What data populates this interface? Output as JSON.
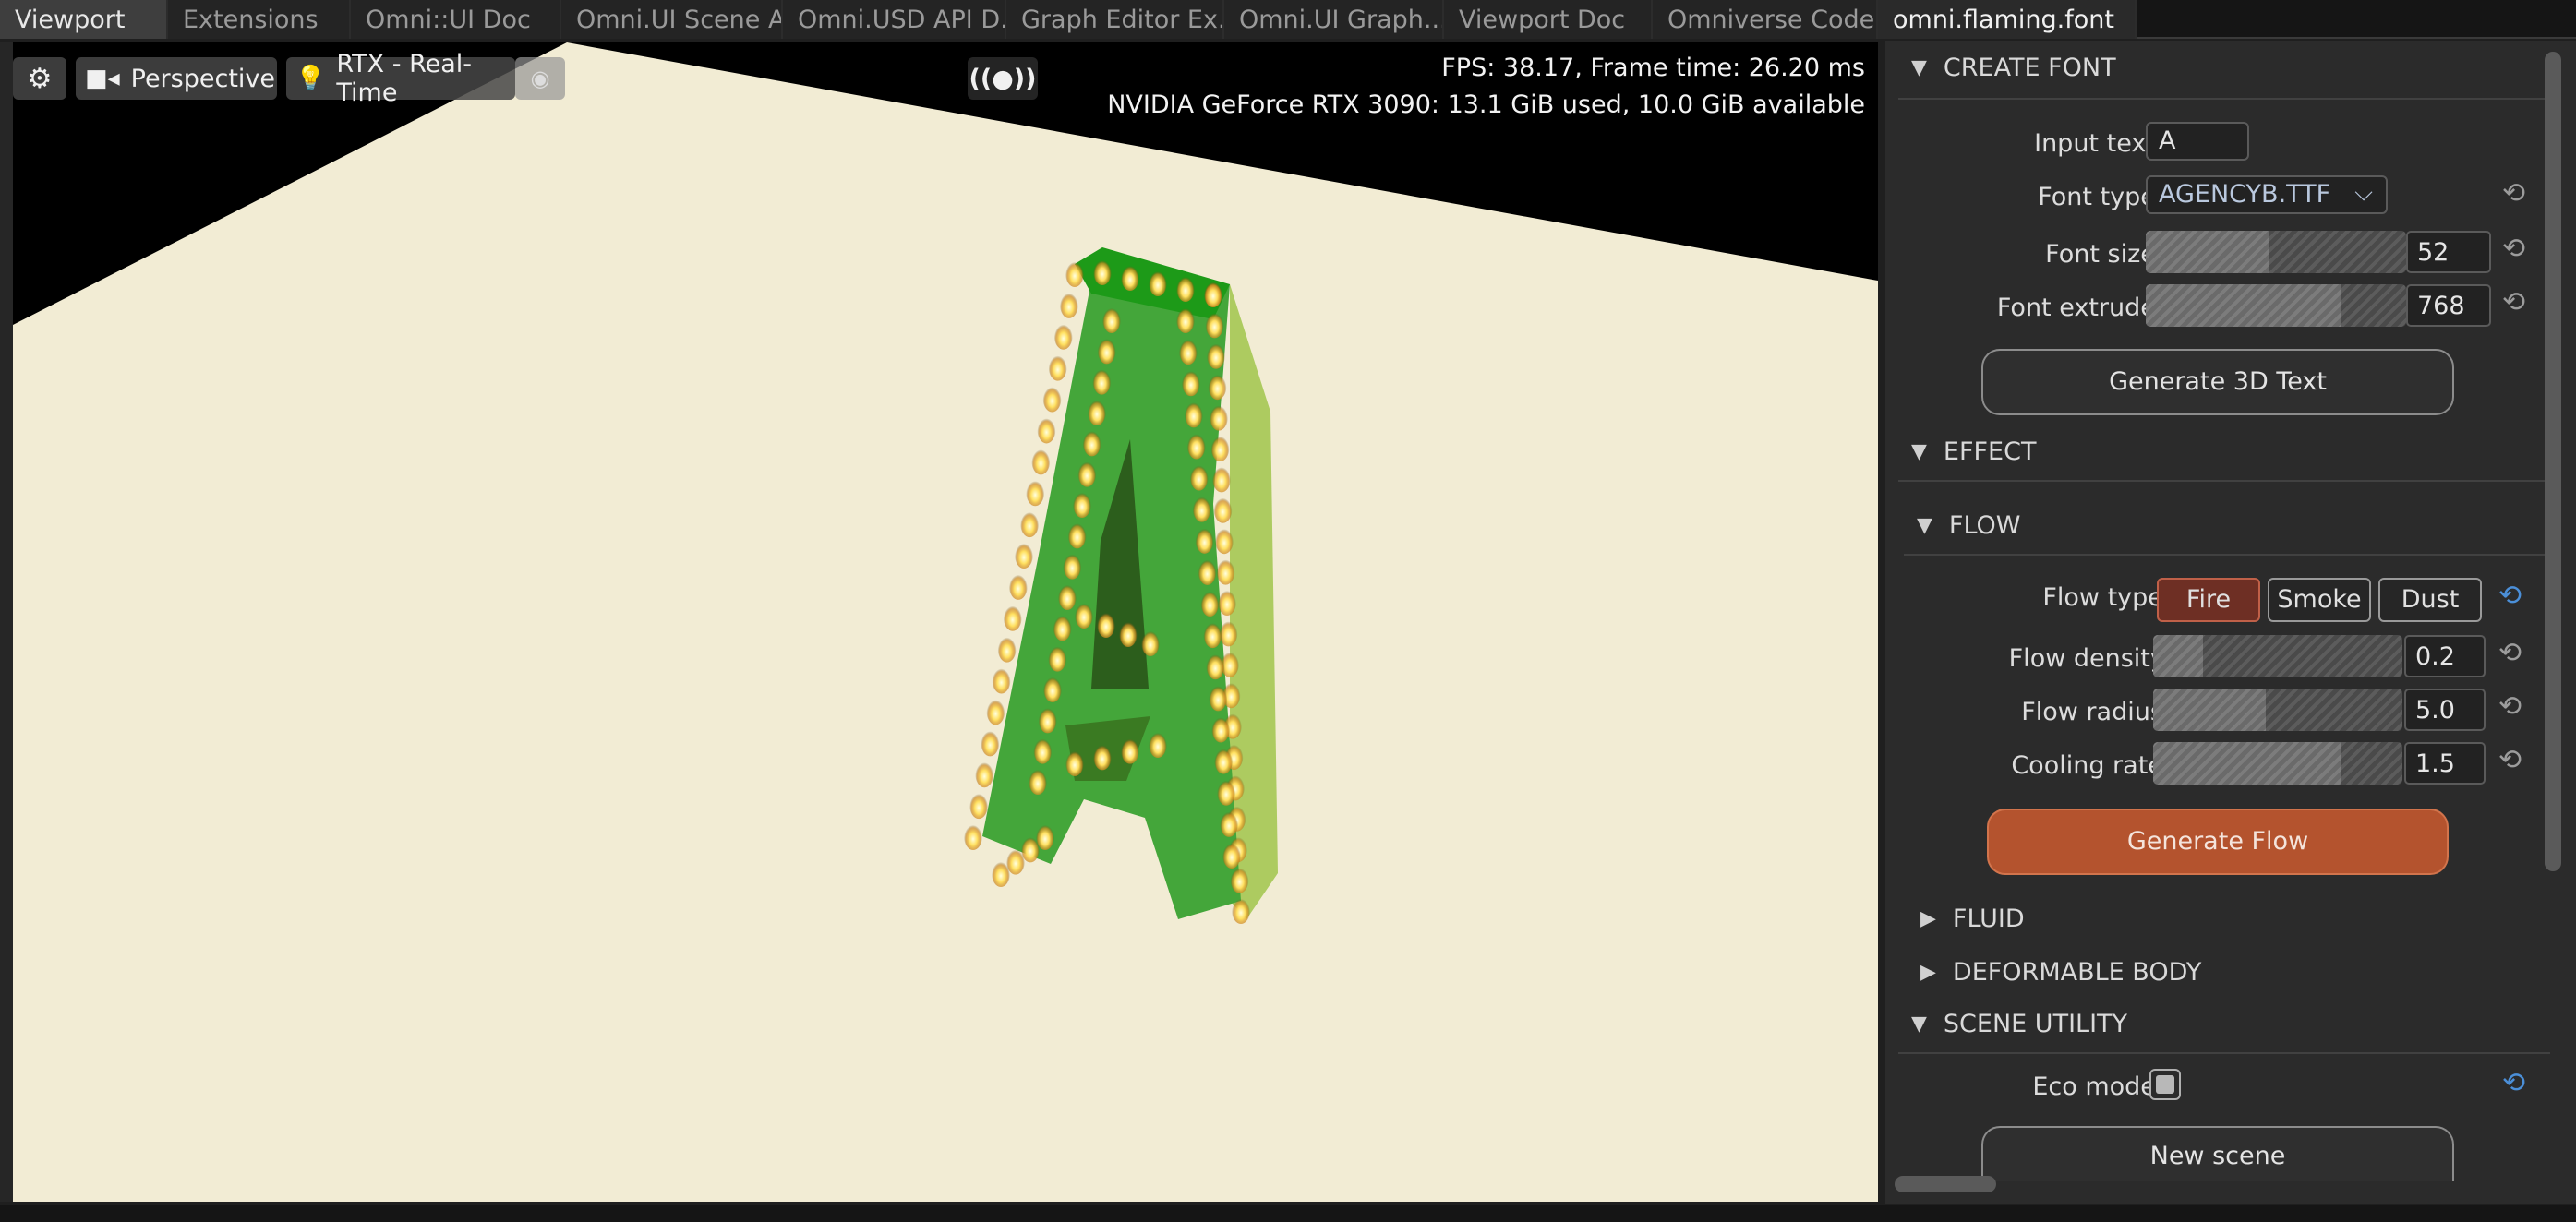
{
  "tabs": [
    "Viewport",
    "Extensions",
    "Omni::UI Doc",
    "Omni.UI Scene A...",
    "Omni.USD API D...",
    "Graph Editor Ex...",
    "Omni.UI Graph...",
    "Viewport Doc",
    "Omniverse Code...",
    "omni.flaming.font"
  ],
  "viewport": {
    "toolbar": {
      "camera": "Perspective",
      "renderer": "RTX - Real-Time",
      "broadcast": "((●))"
    },
    "hud": {
      "fps": "FPS: 38.17, Frame time: 26.20 ms",
      "gpu": "NVIDIA GeForce RTX 3090: 13.1 GiB used,  10.0 GiB available"
    },
    "colors": {
      "floor": "#f2ecd4",
      "letter": "#3a9d2a",
      "letter_top": "#1fa11a",
      "letter_side": "#a6c856"
    }
  },
  "panel": {
    "create_font": {
      "title": "CREATE FONT",
      "input_text_label": "Input text:",
      "input_text_value": "A",
      "font_type_label": "Font type:",
      "font_type_value": "AGENCYB.TTF",
      "font_size_label": "Font size:",
      "font_size_value": "52",
      "font_size_fraction": 0.47,
      "font_extrude_label": "Font extrude:",
      "font_extrude_value": "768",
      "font_extrude_fraction": 0.75,
      "generate_button": "Generate 3D Text"
    },
    "effect": {
      "title": "EFFECT"
    },
    "flow": {
      "title": "FLOW",
      "flow_type_label": "Flow type:",
      "flow_types": [
        "Fire",
        "Smoke",
        "Dust"
      ],
      "flow_type_selected": "Fire",
      "density_label": "Flow density:",
      "density_value": "0.2",
      "density_fraction": 0.2,
      "radius_label": "Flow radius:",
      "radius_value": "5.0",
      "radius_fraction": 0.45,
      "cooling_label": "Cooling rate:",
      "cooling_value": "1.5",
      "cooling_fraction": 0.75,
      "generate_button": "Generate Flow"
    },
    "fluid": {
      "title": "FLUID"
    },
    "deformable": {
      "title": "DEFORMABLE BODY"
    },
    "scene_utility": {
      "title": "SCENE UTILITY",
      "eco_label": "Eco mode:",
      "new_scene_button": "New scene"
    }
  }
}
